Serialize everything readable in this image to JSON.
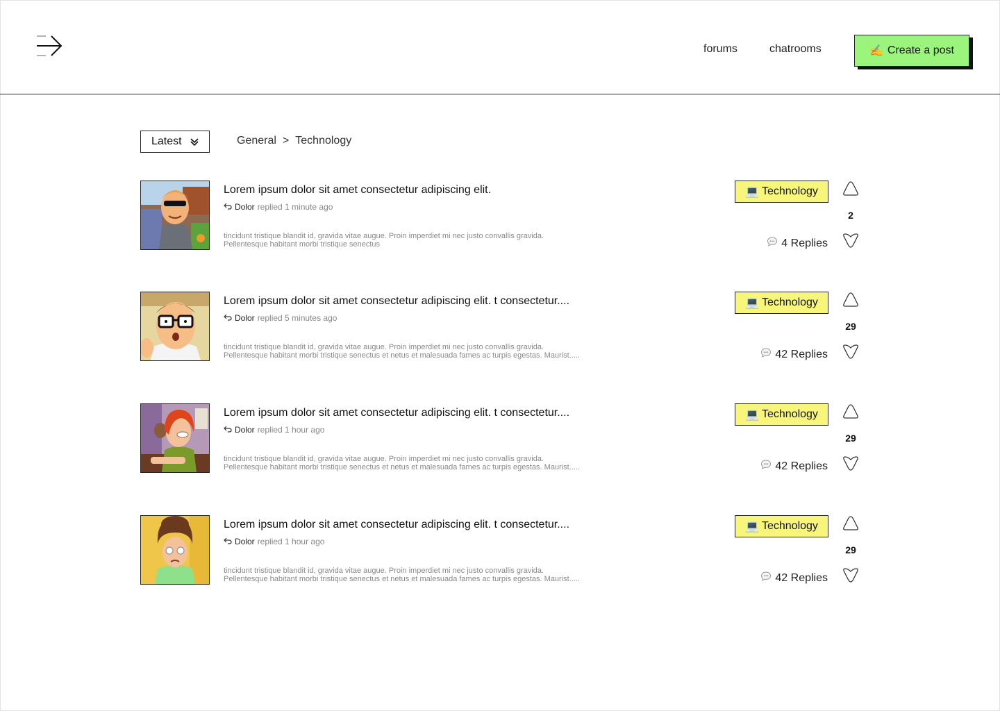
{
  "header": {
    "nav": [
      {
        "label": "forums"
      },
      {
        "label": "chatrooms"
      }
    ],
    "create_button": {
      "emoji": "✍️",
      "label": "Create a post"
    },
    "accent_color": "#9bf57d"
  },
  "toolbar": {
    "sort_label": "Latest",
    "breadcrumb": {
      "root": "General",
      "separator": ">",
      "current": "Technology"
    }
  },
  "tag_color": "#f8f67a",
  "posts": [
    {
      "title": "Lorem ipsum dolor sit amet consectetur adipiscing elit.",
      "author": "Dolor",
      "activity": "replied 1 minute ago",
      "excerpt_line1": "tincidunt tristique blandit id, gravida vitae augue. Proin imperdiet mi nec justo convallis gravida.",
      "excerpt_line2": "Pellentesque habitant morbi tristique senectus",
      "tag_emoji": "💻",
      "tag": "Technology",
      "replies": "4 Replies",
      "votes": "2"
    },
    {
      "title": "Lorem ipsum dolor sit amet consectetur adipiscing elit. t consectetur....",
      "author": "Dolor",
      "activity": "replied 5 minutes ago",
      "excerpt_line1": "tincidunt tristique blandit id, gravida vitae augue. Proin imperdiet mi nec justo convallis gravida.",
      "excerpt_line2": "Pellentesque habitant morbi tristique senectus et netus et malesuada fames ac turpis egestas. Maurist.....",
      "tag_emoji": "💻",
      "tag": "Technology",
      "replies": "42 Replies",
      "votes": "29"
    },
    {
      "title": "Lorem ipsum dolor sit amet consectetur adipiscing elit. t consectetur....",
      "author": "Dolor",
      "activity": "replied 1 hour ago",
      "excerpt_line1": "tincidunt tristique blandit id, gravida vitae augue. Proin imperdiet mi nec justo convallis gravida.",
      "excerpt_line2": "Pellentesque habitant morbi tristique senectus et netus et malesuada fames ac turpis egestas. Maurist.....",
      "tag_emoji": "💻",
      "tag": "Technology",
      "replies": "42 Replies",
      "votes": "29"
    },
    {
      "title": "Lorem ipsum dolor sit amet consectetur adipiscing elit. t consectetur....",
      "author": "Dolor",
      "activity": "replied 1 hour ago",
      "excerpt_line1": "tincidunt tristique blandit id, gravida vitae augue. Proin imperdiet mi nec justo convallis gravida.",
      "excerpt_line2": "Pellentesque habitant morbi tristique senectus et netus et malesuada fames ac turpis egestas. Maurist.....",
      "tag_emoji": "💻",
      "tag": "Technology",
      "replies": "42 Replies",
      "votes": "29"
    }
  ]
}
